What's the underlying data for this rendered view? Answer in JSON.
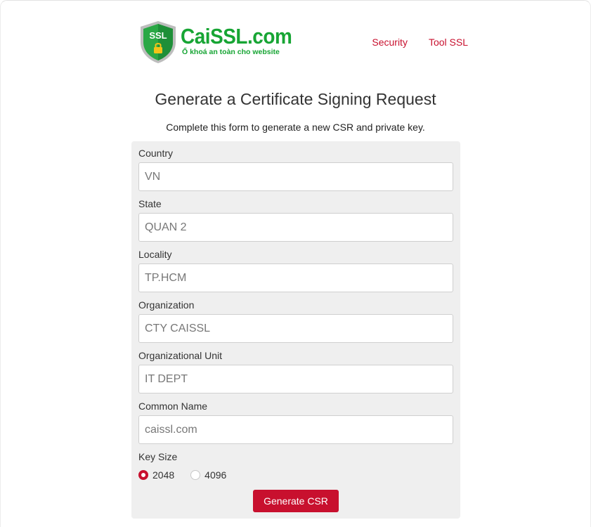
{
  "brand": {
    "shield_text": "SSL",
    "name": "CaiSSL.com",
    "tagline": "Ổ khoá an toàn cho website"
  },
  "nav": [
    {
      "label": "Security"
    },
    {
      "label": "Tool SSL"
    }
  ],
  "page": {
    "title": "Generate a Certificate Signing Request",
    "subtitle": "Complete this form to generate a new CSR and private key."
  },
  "form": {
    "fields": [
      {
        "label": "Country",
        "value": "VN"
      },
      {
        "label": "State",
        "value": "QUAN 2"
      },
      {
        "label": "Locality",
        "value": "TP.HCM"
      },
      {
        "label": "Organization",
        "value": "CTY CAISSL"
      },
      {
        "label": "Organizational Unit",
        "value": "IT DEPT"
      },
      {
        "label": "Common Name",
        "value": "caissl.com"
      }
    ],
    "key_size": {
      "label": "Key Size",
      "options": [
        {
          "label": "2048",
          "selected": true
        },
        {
          "label": "4096",
          "selected": false
        }
      ]
    },
    "submit_label": "Generate CSR"
  },
  "colors": {
    "brand_green": "#17a534",
    "accent_red": "#c8102e",
    "card_bg": "#efefef"
  }
}
